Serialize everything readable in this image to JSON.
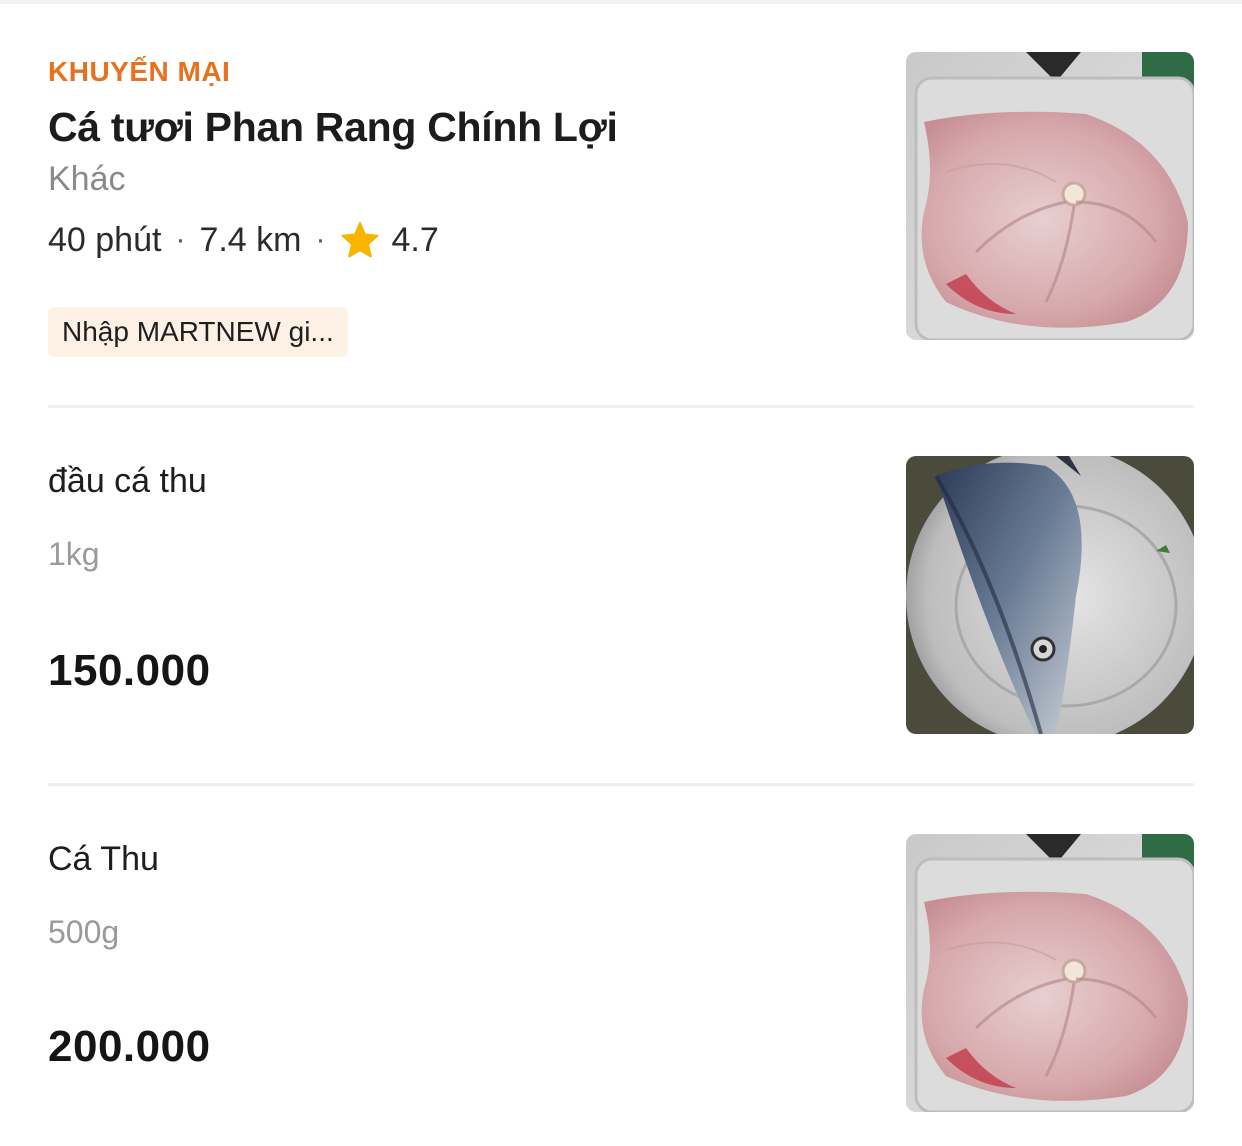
{
  "store": {
    "promo_label": "KHUYẾN MẠI",
    "name": "Cá tươi Phan Rang Chính Lợi",
    "category": "Khác",
    "delivery_time": "40 phút",
    "distance": "7.4 km",
    "rating": "4.7",
    "separator": "·",
    "voucher": "Nhập MARTNEW gi...",
    "image_icon": "fish-steak-photo"
  },
  "items": [
    {
      "name": "đầu cá thu",
      "unit": "1kg",
      "price": "150.000",
      "image_icon": "mackerel-head-photo"
    },
    {
      "name": "Cá Thu",
      "unit": "500g",
      "price": "200.000",
      "image_icon": "fish-steak-photo"
    }
  ],
  "colors": {
    "promo": "#e8711d",
    "voucher_bg": "#fdf1e5",
    "star": "#f7b500",
    "divider": "#efefef"
  }
}
